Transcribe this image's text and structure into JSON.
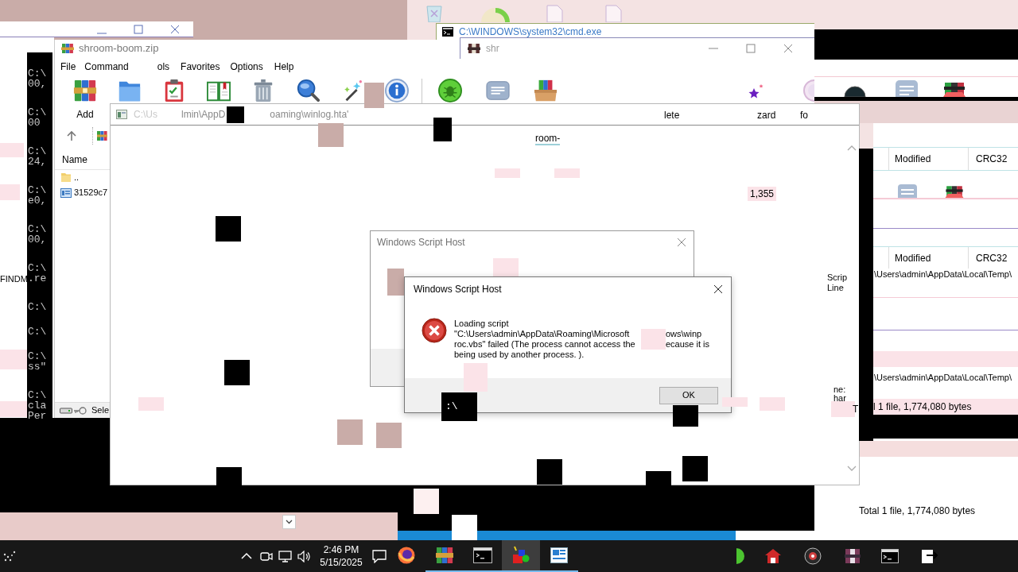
{
  "winrar": {
    "title": "shroom-boom.zip",
    "menu": [
      "File",
      "Command",
      "ols",
      "Favorites",
      "Options",
      "Help"
    ],
    "toolbar_label": "Add",
    "list_header": "Name",
    "rows": [
      {
        "kind": "folder",
        "name": ".."
      },
      {
        "kind": "file",
        "name": "31529c7"
      }
    ],
    "status": "Sele"
  },
  "toolbar_fragments": [
    "lete",
    "zard",
    "fo"
  ],
  "cmd_window": {
    "title": "C:\\WINDOWS\\system32\\cmd.exe",
    "lines": [
      [
        "C:\\",
        "00,"
      ],
      [
        "C:\\",
        "00"
      ],
      [
        "C:\\",
        "24,"
      ],
      [
        "C:\\",
        "e0,"
      ],
      [
        "C:\\",
        "00,"
      ],
      [
        "C:\\",
        ".re"
      ],
      [
        "C:\\"
      ],
      [
        "C:\\"
      ],
      [
        "C:\\",
        "ss\""
      ],
      [
        "C:\\",
        "cla",
        "Per"
      ]
    ]
  },
  "second_window": {
    "title": "shr"
  },
  "hta_window": {
    "title_parts": [
      "C:\\Us",
      "lmin\\AppD",
      "oaming\\winlog.hta'"
    ],
    "path_fragment": "room-",
    "size": "1,355"
  },
  "left_fragment": "FINDM",
  "right_panel": {
    "headers": [
      [
        "Modified",
        "CRC32"
      ],
      [
        "Modified",
        "CRC32"
      ]
    ],
    "labels": [
      "Scrip",
      "Line",
      "ne:",
      "har"
    ],
    "paths": [
      "\\Users\\admin\\AppData\\Local\\Temp\\",
      "\\Users\\admin\\AppData\\Local\\Temp\\"
    ],
    "status_initial": "T",
    "status": "l 1 file, 1,774,080 bytes",
    "bottom_status": "Total 1 file, 1,774,080 bytes"
  },
  "dialogs": [
    {
      "title": "Windows Script Host"
    },
    {
      "title": "Windows Script Host",
      "message": [
        [
          "Loading script"
        ],
        [
          "\"C:\\Users\\admin\\AppData\\Roaming\\Microsoft",
          "ows\\winp"
        ],
        [
          "roc.vbs\" failed (The process cannot access the",
          "ecause it is"
        ],
        [
          "being used by another process. )."
        ]
      ],
      "button": "OK"
    }
  ],
  "console_fragment": ":\\",
  "taskbar": {
    "time": "2:46 PM",
    "date": "5/15/2025",
    "apps": [
      {
        "kind": "browser",
        "running": false,
        "selected": false
      },
      {
        "kind": "archiver",
        "running": true,
        "selected": false
      },
      {
        "kind": "terminal",
        "running": true,
        "selected": false
      },
      {
        "kind": "paint",
        "running": true,
        "selected": true
      },
      {
        "kind": "viewer",
        "running": true,
        "selected": false
      }
    ]
  }
}
